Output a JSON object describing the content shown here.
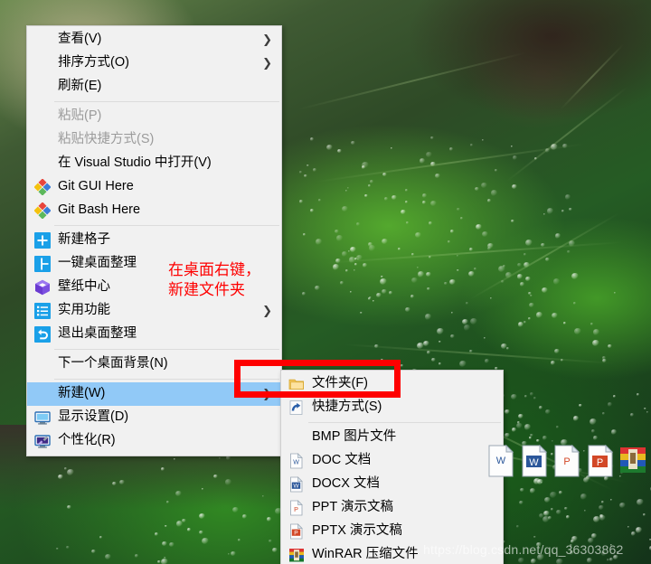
{
  "desktop": {
    "wallpaper_description": "green leaf with water droplets",
    "watermark": "https://blog.csdn.net/qq_36303862"
  },
  "context_menu": {
    "name": "desktop-context-menu",
    "items": [
      {
        "label": "查看(V)",
        "icon": "none",
        "submenu": true,
        "disabled": false,
        "selected": false
      },
      {
        "label": "排序方式(O)",
        "icon": "none",
        "submenu": true,
        "disabled": false,
        "selected": false
      },
      {
        "label": "刷新(E)",
        "icon": "none",
        "submenu": false,
        "disabled": false,
        "selected": false
      },
      {
        "separator": true
      },
      {
        "label": "粘贴(P)",
        "icon": "none",
        "submenu": false,
        "disabled": true,
        "selected": false
      },
      {
        "label": "粘贴快捷方式(S)",
        "icon": "none",
        "submenu": false,
        "disabled": true,
        "selected": false
      },
      {
        "label": "在 Visual Studio 中打开(V)",
        "icon": "none",
        "submenu": false,
        "disabled": false,
        "selected": false
      },
      {
        "label": "Git GUI Here",
        "icon": "git-icon",
        "submenu": false,
        "disabled": false,
        "selected": false
      },
      {
        "label": "Git Bash Here",
        "icon": "git-icon",
        "submenu": false,
        "disabled": false,
        "selected": false
      },
      {
        "separator": true
      },
      {
        "label": "新建格子",
        "icon": "plus-square-icon",
        "submenu": false,
        "disabled": false,
        "selected": false
      },
      {
        "label": "一键桌面整理",
        "icon": "layout-icon",
        "submenu": false,
        "disabled": false,
        "selected": false
      },
      {
        "label": "壁纸中心",
        "icon": "cube-icon",
        "submenu": false,
        "disabled": false,
        "selected": false
      },
      {
        "label": "实用功能",
        "icon": "list-icon",
        "submenu": true,
        "disabled": false,
        "selected": false
      },
      {
        "label": "退出桌面整理",
        "icon": "undo-icon",
        "submenu": false,
        "disabled": false,
        "selected": false
      },
      {
        "separator": true
      },
      {
        "label": "下一个桌面背景(N)",
        "icon": "none",
        "submenu": false,
        "disabled": false,
        "selected": false
      },
      {
        "separator": true
      },
      {
        "label": "新建(W)",
        "icon": "none",
        "submenu": true,
        "disabled": false,
        "selected": true
      },
      {
        "label": "显示设置(D)",
        "icon": "monitor-icon",
        "submenu": false,
        "disabled": false,
        "selected": false
      },
      {
        "label": "个性化(R)",
        "icon": "personalize-icon",
        "submenu": false,
        "disabled": false,
        "selected": false
      }
    ]
  },
  "submenu": {
    "name": "new-item-submenu",
    "items": [
      {
        "label": "文件夹(F)",
        "icon": "folder-icon",
        "separator_after": false
      },
      {
        "label": "快捷方式(S)",
        "icon": "shortcut-icon",
        "separator_after": true
      },
      {
        "label": "BMP 图片文件",
        "icon": "none",
        "separator_after": false
      },
      {
        "label": "DOC 文档",
        "icon": "word-doc-icon",
        "separator_after": false
      },
      {
        "label": "DOCX 文档",
        "icon": "word-docx-icon",
        "separator_after": false
      },
      {
        "label": "PPT 演示文稿",
        "icon": "ppt-icon",
        "separator_after": false
      },
      {
        "label": "PPTX 演示文稿",
        "icon": "pptx-icon",
        "separator_after": false
      },
      {
        "label": "WinRAR 压缩文件",
        "icon": "winrar-icon",
        "separator_after": false
      }
    ]
  },
  "annotation": {
    "line1": "在桌面右键，",
    "line2": "新建文件夹",
    "color": "#fe0000",
    "highlight_rect_color": "#fe0000"
  }
}
